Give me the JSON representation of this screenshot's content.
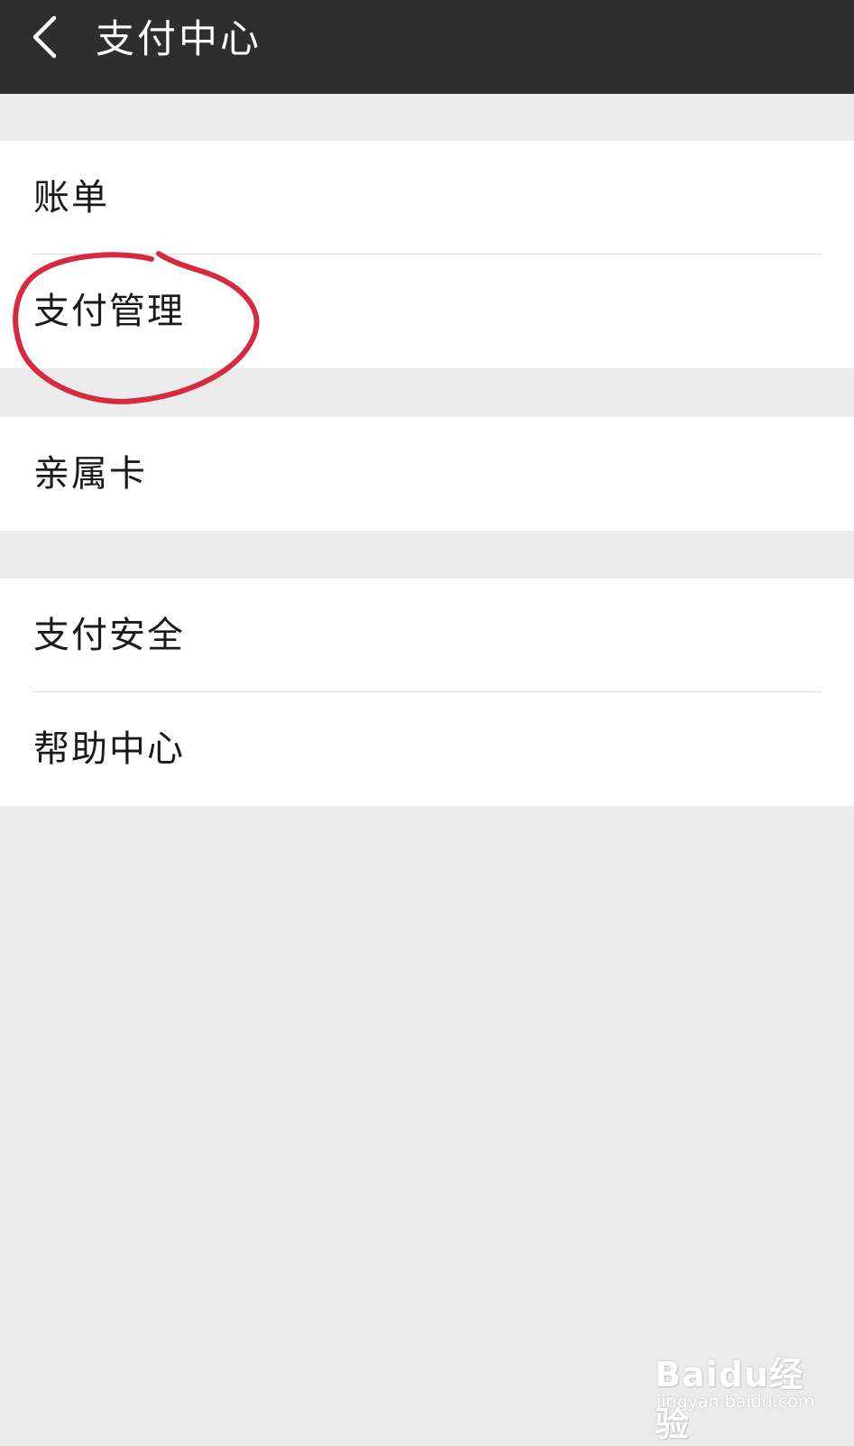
{
  "header": {
    "back_icon": "chevron-left-icon",
    "title": "支付中心"
  },
  "groups": [
    {
      "items": [
        {
          "label": "账单"
        },
        {
          "label": "支付管理"
        }
      ]
    },
    {
      "items": [
        {
          "label": "亲属卡"
        }
      ]
    },
    {
      "items": [
        {
          "label": "支付安全"
        },
        {
          "label": "帮助中心"
        }
      ]
    }
  ],
  "annotation": {
    "color": "#d62a3f",
    "target": "支付管理"
  },
  "watermark": {
    "logo": "Baidu经验",
    "url": "jingyan.baidu.com"
  },
  "colors": {
    "header_bg": "#2e2e2e",
    "page_bg": "#ebebeb",
    "item_bg": "#ffffff"
  }
}
